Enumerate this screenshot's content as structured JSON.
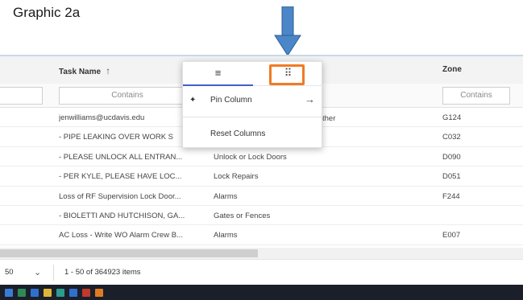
{
  "caption": "Graphic 2a",
  "grid": {
    "headers": {
      "task_name": "Task Name",
      "zone": "Zone"
    },
    "filters": {
      "task_placeholder": "Contains",
      "zone_placeholder": "Contains"
    },
    "rows": [
      {
        "task": "jenwilliams@ucdavis.edu",
        "category": "",
        "zone": "G124"
      },
      {
        "task": "- PIPE LEAKING OVER WORK S",
        "category": "",
        "zone": "C032"
      },
      {
        "task": "- PLEASE UNLOCK ALL ENTRAN...",
        "category": "Unlock or Lock Doors",
        "zone": "D090"
      },
      {
        "task": "- PER KYLE, PLEASE HAVE LOC...",
        "category": "Lock Repairs",
        "zone": "D051"
      },
      {
        "task": "Loss of RF Supervision Lock Door...",
        "category": "Alarms",
        "zone": "F244"
      },
      {
        "task": "- BIOLETTI AND HUTCHISON, GA...",
        "category": "Gates or Fences",
        "zone": ""
      },
      {
        "task": "AC Loss - Write WO Alarm Crew B...",
        "category": "Alarms",
        "zone": "E007"
      }
    ],
    "peek_text": "ther"
  },
  "pager": {
    "page_size": "50",
    "page_info": "1 - 50 of 364923 items"
  },
  "menu": {
    "tabs": [
      {
        "icon": "menu-lines-icon",
        "glyph": "≡"
      },
      {
        "icon": "grid-dots-icon",
        "glyph": "⠿"
      }
    ],
    "items": [
      {
        "label": "Pin Column",
        "icon": "pin-icon",
        "glyph": "📌",
        "arrow": "→"
      },
      {
        "label": "Reset Columns"
      }
    ]
  },
  "colors": {
    "arrow": "#4a86c8",
    "highlight": "#f07b24",
    "active_tab": "#4060c8"
  }
}
